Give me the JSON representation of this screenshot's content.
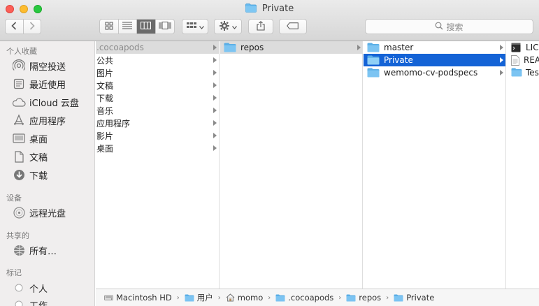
{
  "window": {
    "title": "Private"
  },
  "toolbar": {
    "search_placeholder": "搜索"
  },
  "sidebar": {
    "sections": [
      {
        "header": "个人收藏"
      },
      {
        "header": "设备"
      },
      {
        "header": "共享的"
      },
      {
        "header": "标记"
      }
    ],
    "favorites": [
      {
        "label": "隔空投送",
        "icon": "airdrop-icon"
      },
      {
        "label": "最近使用",
        "icon": "recents-icon"
      },
      {
        "label": "iCloud 云盘",
        "icon": "icloud-icon"
      },
      {
        "label": "应用程序",
        "icon": "applications-icon"
      },
      {
        "label": "桌面",
        "icon": "desktop-icon"
      },
      {
        "label": "文稿",
        "icon": "documents-icon"
      },
      {
        "label": "下载",
        "icon": "downloads-icon"
      }
    ],
    "devices": [
      {
        "label": "远程光盘",
        "icon": "disc-icon"
      }
    ],
    "shared": [
      {
        "label": "所有…",
        "icon": "network-icon"
      }
    ],
    "tags": [
      {
        "label": "个人"
      },
      {
        "label": "工作"
      }
    ]
  },
  "columns": {
    "col1": [
      {
        "label": ".cocoapods",
        "state": "selected-inactive"
      },
      {
        "label": "公共"
      },
      {
        "label": "图片"
      },
      {
        "label": "文稿"
      },
      {
        "label": "下载"
      },
      {
        "label": "音乐"
      },
      {
        "label": "应用程序"
      },
      {
        "label": "影片"
      },
      {
        "label": "桌面"
      }
    ],
    "col2": [
      {
        "label": "repos",
        "state": "selected-inactive"
      }
    ],
    "col3": [
      {
        "label": "master"
      },
      {
        "label": "Private",
        "state": "selected-active"
      },
      {
        "label": "wemomo-cv-podspecs"
      }
    ],
    "col4": [
      {
        "label": "LIC",
        "icon": "terminal-file-icon"
      },
      {
        "label": "REA",
        "icon": "text-file-icon"
      },
      {
        "label": "Tes",
        "icon": "folder-icon"
      }
    ]
  },
  "pathbar": {
    "crumbs": [
      {
        "label": "Macintosh HD",
        "icon": "hard-drive-icon"
      },
      {
        "label": "用户",
        "icon": "folder-icon"
      },
      {
        "label": "momo",
        "icon": "home-icon"
      },
      {
        "label": ".cocoapods",
        "icon": "folder-icon"
      },
      {
        "label": "repos",
        "icon": "folder-icon"
      },
      {
        "label": "Private",
        "icon": "folder-icon"
      }
    ]
  },
  "colors": {
    "selection_active": "#1463d6",
    "selection_inactive": "#dcdcdc",
    "folder_blue": "#5fb7ec"
  }
}
